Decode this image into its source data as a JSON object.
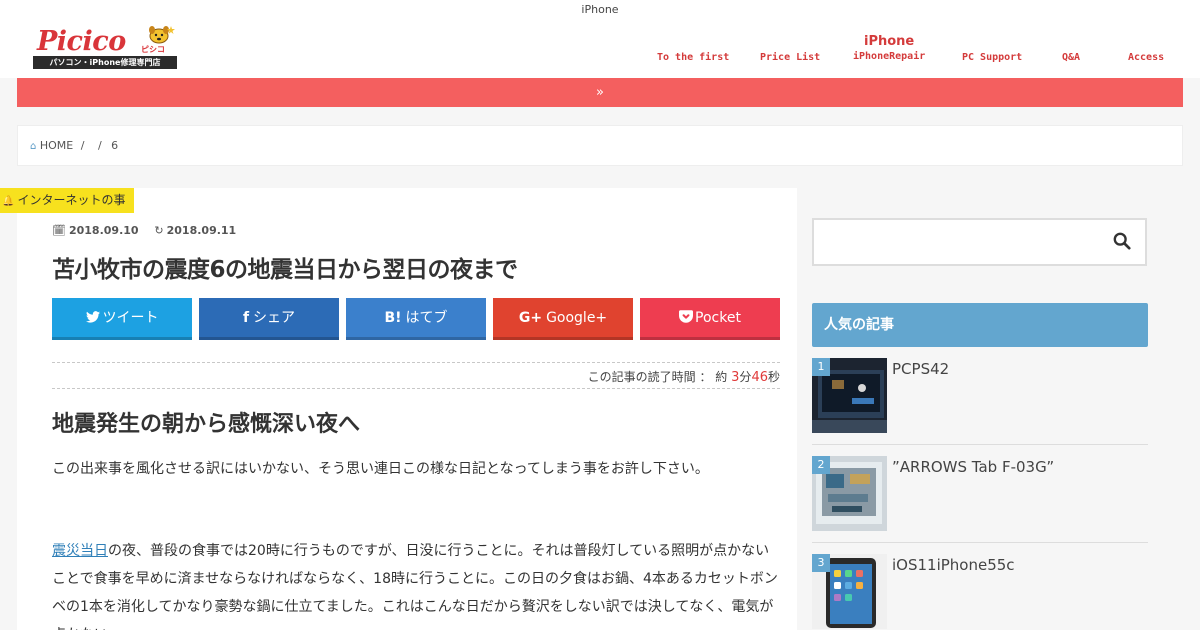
{
  "site": {
    "top_title": "iPhone",
    "logo_word": "Picico",
    "logo_kana": "ピシコ",
    "logo_tagline": "パソコン・iPhone修理専門店"
  },
  "nav": {
    "items": [
      {
        "label": "To the first"
      },
      {
        "label": "Price List"
      },
      {
        "label_top": "iPhone",
        "label": "iPhoneRepair"
      },
      {
        "label": "PC Support"
      },
      {
        "label": "Q&A"
      },
      {
        "label": "Access"
      }
    ]
  },
  "redbar": {
    "icon_text": "»"
  },
  "breadcrumb": {
    "home": "HOME",
    "sep1": "/",
    "sep2": "/",
    "current": "6"
  },
  "category_tag": "インターネットの事",
  "article": {
    "published": "2018.09.10",
    "updated": "2018.09.11",
    "title": "苫小牧市の震度6の地震当日から翌日の夜まで",
    "share": [
      {
        "label": "ツイート",
        "icon_text": "",
        "color": "#1da1e2"
      },
      {
        "label": "シェア",
        "icon_text": "f",
        "color": "#2c6bb6"
      },
      {
        "label": "はてブ",
        "icon_text": "B!",
        "color": "#3b80cc"
      },
      {
        "label": "Google+",
        "icon_text": "G+",
        "color": "#e0432f"
      },
      {
        "label": "Pocket",
        "icon_text": "",
        "color": "#ee3d50"
      }
    ],
    "readtime": {
      "prefix": "この記事の読了時間 ： 約",
      "minutes": "3",
      "min_unit": "分",
      "seconds": "46",
      "sec_unit": "秒"
    },
    "heading": "地震発生の朝から感慨深い夜へ",
    "para1": "この出来事を風化させる訳にはいかない、そう思い連日この様な日記となってしまう事をお許し下さい。",
    "para2_link": "震災当日",
    "para2_rest": "の夜、普段の食事では20時に行うものですが、日没に行うことに。それは普段灯している照明が点かないことで食事を早めに済ませならなければならなく、18時に行うことに。この日の夕食はお鍋、4本あるカセットボンベの1本を消化してかなり豪勢な鍋に仕立てました。これはこんな日だから贅沢をしない訳では決してなく、電気が点かない"
  },
  "sidebar": {
    "popular_title": "人気の記事",
    "popular": [
      {
        "rank": "1",
        "title": "PCPS42"
      },
      {
        "rank": "2",
        "title": "”ARROWS Tab F-03G”"
      },
      {
        "rank": "3",
        "title": "iOS11iPhone55c"
      }
    ]
  },
  "colors": {
    "accent_red": "#f45f5f",
    "accent_blue": "#63a6cf",
    "tag_yellow": "#f7e11e"
  }
}
